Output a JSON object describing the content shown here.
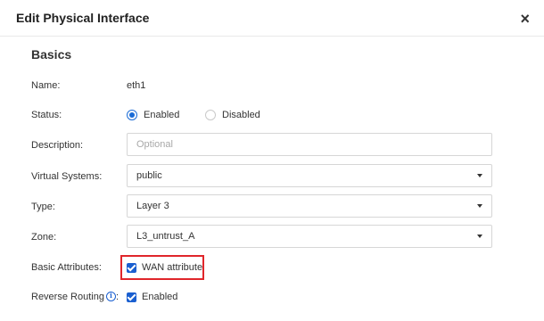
{
  "dialog": {
    "title": "Edit Physical Interface",
    "close_icon": "×"
  },
  "section_title": "Basics",
  "fields": {
    "name": {
      "label": "Name:",
      "value": "eth1"
    },
    "status": {
      "label": "Status:",
      "options": [
        {
          "label": "Enabled",
          "checked": true
        },
        {
          "label": "Disabled",
          "checked": false
        }
      ]
    },
    "description": {
      "label": "Description:",
      "value": "",
      "placeholder": "Optional"
    },
    "virtual_systems": {
      "label": "Virtual Systems:",
      "selected": "public"
    },
    "type": {
      "label": "Type:",
      "selected": "Layer 3"
    },
    "zone": {
      "label": "Zone:",
      "selected": "L3_untrust_A"
    },
    "basic_attributes": {
      "label": "Basic Attributes:",
      "checkbox_label": "WAN attribute",
      "checked": true
    },
    "reverse_routing": {
      "label": "Reverse Routing",
      "suffix": ":",
      "info_icon": "i",
      "checkbox_label": "Enabled",
      "checked": true
    }
  },
  "colors": {
    "accent": "#1a5fd0",
    "highlight": "#e0262b"
  }
}
